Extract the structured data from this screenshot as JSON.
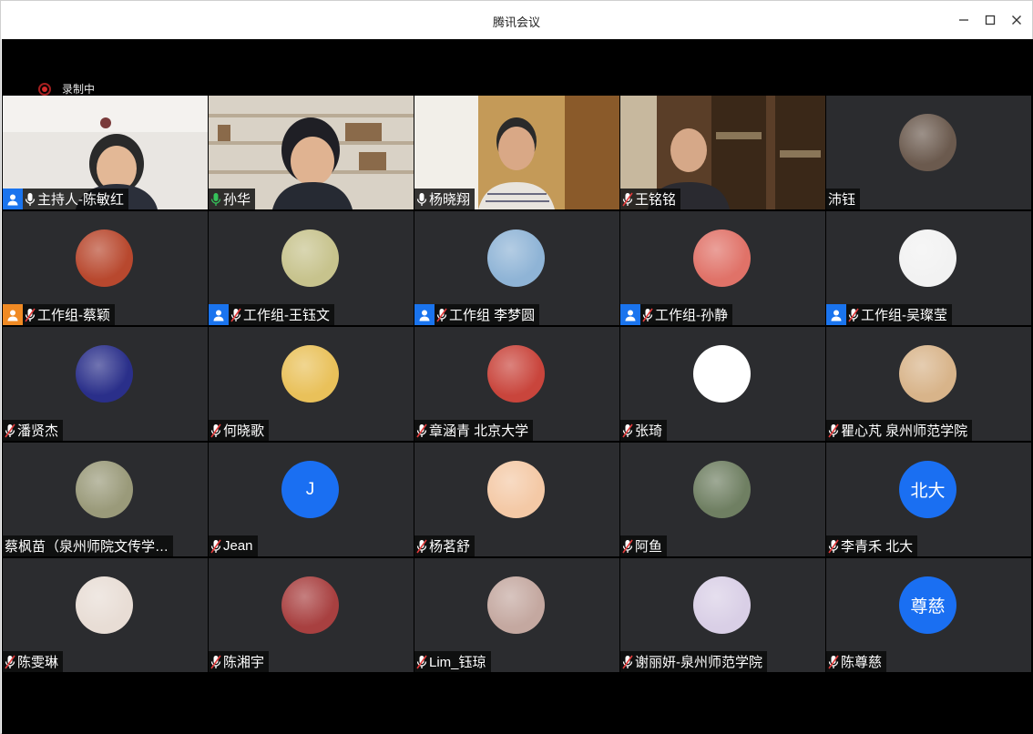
{
  "window": {
    "title": "腾讯会议"
  },
  "recording": {
    "label": "录制中"
  },
  "tiles": [
    {
      "name": "主持人-陈敏红",
      "role": "host",
      "mic": "on",
      "kind": "video",
      "scene": "white-wall"
    },
    {
      "name": "孙华",
      "role": "",
      "mic": "on-green",
      "kind": "video",
      "scene": "bookshelf"
    },
    {
      "name": "杨晓翔",
      "role": "",
      "mic": "on",
      "kind": "video",
      "scene": "wood-door"
    },
    {
      "name": "王铭铭",
      "role": "",
      "mic": "muted",
      "kind": "video",
      "scene": "study"
    },
    {
      "name": "沛钰",
      "role": "",
      "mic": "none",
      "kind": "avatar",
      "avatar_color": "#6b5a4e"
    },
    {
      "name": "工作组-蔡颖",
      "role": "host-orange",
      "mic": "muted",
      "kind": "avatar",
      "avatar_color": "#b8482e"
    },
    {
      "name": "工作组-王钰文",
      "role": "host",
      "mic": "muted",
      "kind": "avatar",
      "avatar_color": "#c7c38d"
    },
    {
      "name": "工作组 李梦圆",
      "role": "host",
      "mic": "muted",
      "kind": "avatar",
      "avatar_color": "#8fb4d6"
    },
    {
      "name": "工作组-孙静",
      "role": "host",
      "mic": "muted",
      "kind": "avatar",
      "avatar_color": "#e07268"
    },
    {
      "name": "工作组-吴璨莹",
      "role": "host",
      "mic": "muted",
      "kind": "avatar",
      "avatar_color": "#f2f2f2"
    },
    {
      "name": "潘贤杰",
      "role": "",
      "mic": "muted",
      "kind": "avatar",
      "avatar_color": "#2a2f8a"
    },
    {
      "name": "何晓歌",
      "role": "",
      "mic": "muted",
      "kind": "avatar",
      "avatar_color": "#e9c15a"
    },
    {
      "name": "章涵青 北京大学",
      "role": "",
      "mic": "muted",
      "kind": "avatar",
      "avatar_color": "#c9453c"
    },
    {
      "name": "张琦",
      "role": "",
      "mic": "muted",
      "kind": "avatar",
      "avatar_color": "#ffffff"
    },
    {
      "name": "瞿心芃 泉州师范学院",
      "role": "",
      "mic": "muted",
      "kind": "avatar",
      "avatar_color": "#d8b48a"
    },
    {
      "name": "蔡枫苗（泉州师院文传学…",
      "role": "",
      "mic": "none",
      "kind": "avatar",
      "avatar_color": "#9a9a7a"
    },
    {
      "name": "Jean",
      "role": "",
      "mic": "muted",
      "kind": "letter",
      "avatar_text": "J"
    },
    {
      "name": "杨茗舒",
      "role": "",
      "mic": "muted",
      "kind": "avatar",
      "avatar_color": "#f4c9a6"
    },
    {
      "name": "阿鱼",
      "role": "",
      "mic": "muted",
      "kind": "avatar",
      "avatar_color": "#6f7f62"
    },
    {
      "name": "李青禾 北大",
      "role": "",
      "mic": "muted",
      "kind": "letter",
      "avatar_text": "北大"
    },
    {
      "name": "陈雯琳",
      "role": "",
      "mic": "muted",
      "kind": "avatar",
      "avatar_color": "#e8ddd5"
    },
    {
      "name": "陈湘宇",
      "role": "",
      "mic": "muted",
      "kind": "avatar",
      "avatar_color": "#a84040"
    },
    {
      "name": "Lim_钰琼",
      "role": "",
      "mic": "muted",
      "kind": "avatar",
      "avatar_color": "#c4a8a0"
    },
    {
      "name": "谢丽妍-泉州师范学院",
      "role": "",
      "mic": "muted",
      "kind": "avatar",
      "avatar_color": "#d9cfe6"
    },
    {
      "name": "陈尊慈",
      "role": "",
      "mic": "muted",
      "kind": "letter",
      "avatar_text": "尊慈"
    }
  ],
  "colors": {
    "tile_bg": "#2b2c2f",
    "host_badge": "#1a74ee",
    "host_badge_orange": "#f08a24",
    "letter_avatar": "#1a6ff2",
    "mic_muted": "#e23b3b",
    "active_border": "#2dbe5a"
  }
}
